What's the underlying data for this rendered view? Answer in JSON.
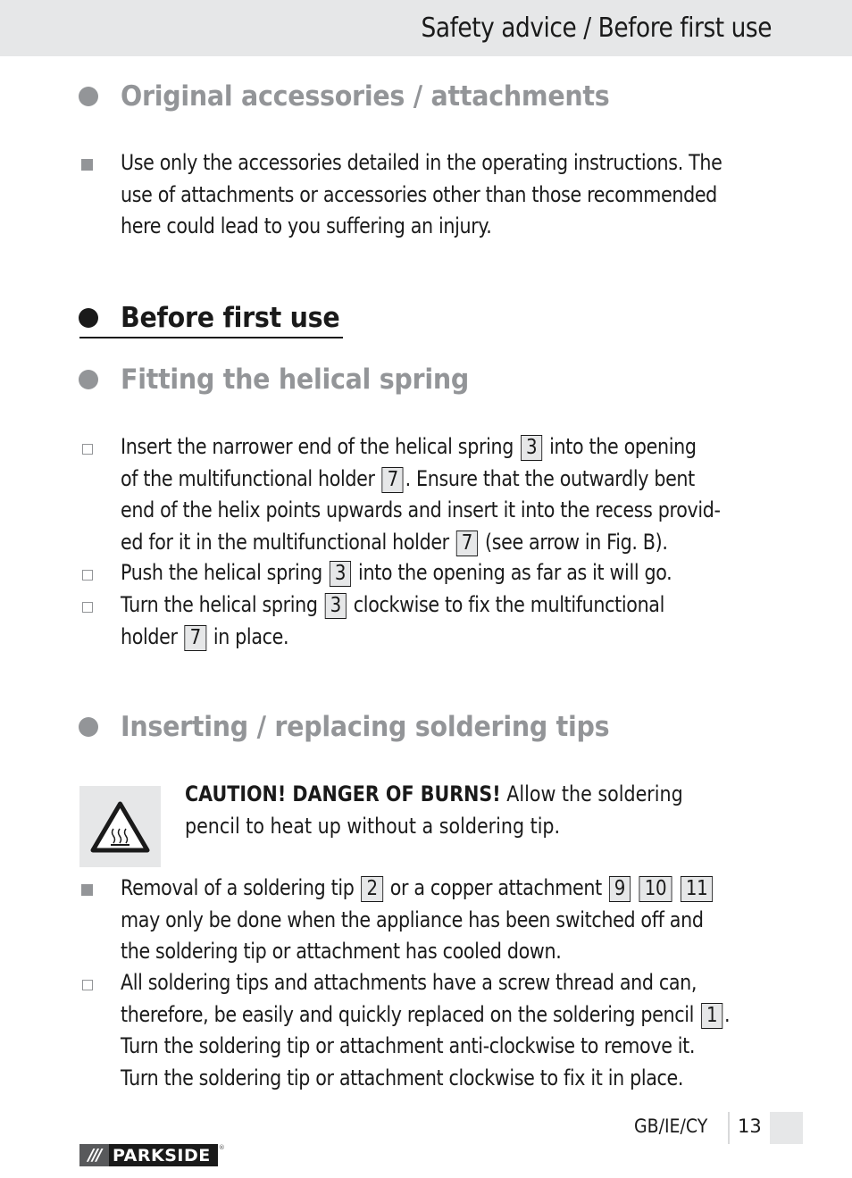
{
  "header": {
    "title": "Safety advice / Before first use"
  },
  "sections": {
    "original_accessories": {
      "heading": "Original accessories / attachments",
      "bullets": [
        {
          "style": "filled",
          "lines": [
            "Use only the accessories detailed in the operating instructions. The",
            "use of attachments or accessories other than those recommended",
            "here could lead to you suffering an injury."
          ]
        }
      ]
    },
    "before_first_use": {
      "heading": "Before first use"
    },
    "fitting_spring": {
      "heading": "Fitting the helical spring",
      "steps": [
        {
          "style": "open",
          "l1a": "Insert the narrower end of the helical spring",
          "l1ref": "3",
          "l1b": "into the opening",
          "l2a": "of the multifunctional holder",
          "l2ref": "7",
          "l2b": ". Ensure that the outwardly bent",
          "l3": "end of the helix points upwards and insert it into the recess provid-",
          "l4a": "ed for it in the multifunctional holder",
          "l4ref": "7",
          "l4b": "(see arrow in Fig. B)."
        },
        {
          "style": "open",
          "l1a": "Push the helical spring",
          "l1ref": "3",
          "l1b": "into the opening as far as it will go."
        },
        {
          "style": "open",
          "l1a": "Turn the helical spring",
          "l1ref": "3",
          "l1b": "clockwise to fix the multifunctional",
          "l2a": "holder",
          "l2ref": "7",
          "l2b": "in place."
        }
      ]
    },
    "soldering_tips": {
      "heading": "Inserting / replacing soldering tips",
      "warning": {
        "icon": "hot-surface-warning-icon",
        "caution": "CAUTION! DANGER OF BURNS!",
        "l1": "Allow the soldering",
        "l2": "pencil to heat up without a soldering tip."
      },
      "steps": [
        {
          "style": "filled",
          "l1a": "Removal of a soldering tip",
          "l1ref1": "2",
          "l1b": "or a copper attachment",
          "l1ref2": "9",
          "l1ref3": "10",
          "l1ref4": "11",
          "l2": "may only be done when the appliance has been switched off and",
          "l3": "the soldering tip or attachment has cooled down."
        },
        {
          "style": "open",
          "l1": "All soldering tips and attachments have a screw thread and can,",
          "l2a": "therefore, be easily and quickly replaced on the soldering pencil",
          "l2ref": "1",
          "l2b": ".",
          "l3": "Turn the soldering tip or attachment anti-clockwise to remove it.",
          "l4": "Turn the soldering tip or attachment clockwise to fix it in place."
        }
      ]
    }
  },
  "footer": {
    "region": "GB/IE/CY",
    "page": "13",
    "logo_slashes": "///",
    "logo_brand": "PARKSIDE",
    "logo_reg": "®"
  },
  "colors": {
    "heading_gray": "#939598",
    "band_gray": "#e6e7e8",
    "text": "#1a1a1a"
  }
}
